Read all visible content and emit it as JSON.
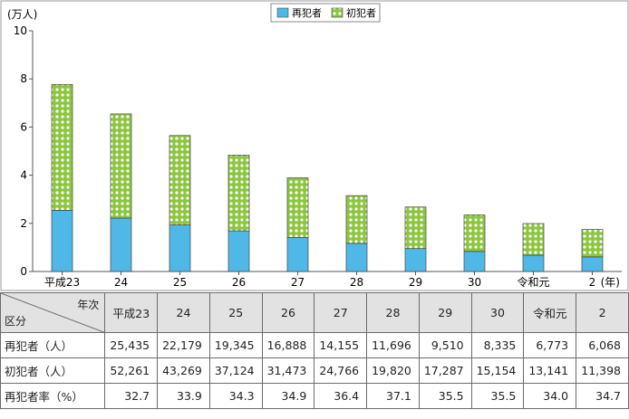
{
  "chart_data": {
    "type": "bar",
    "stacked": true,
    "categories": [
      "平成23",
      "24",
      "25",
      "26",
      "27",
      "28",
      "29",
      "30",
      "令和元",
      "2"
    ],
    "category_unit": "(年)",
    "series": [
      {
        "name": "再犯者",
        "color": "#4fb8e6",
        "values": [
          2.5435,
          2.2179,
          1.9345,
          1.6888,
          1.4155,
          1.1696,
          0.951,
          0.8335,
          0.6773,
          0.6068
        ]
      },
      {
        "name": "初犯者",
        "color": "#8cc63e",
        "pattern": "dotted",
        "values": [
          5.2261,
          4.3269,
          3.7124,
          3.1473,
          2.4766,
          1.982,
          1.7287,
          1.5154,
          1.3141,
          1.1398
        ]
      }
    ],
    "y_unit": "(万人)",
    "yticks": [
      "0",
      "2",
      "4",
      "6",
      "8",
      "10"
    ],
    "ylim": [
      0,
      10
    ],
    "grid": false,
    "legend": "top-center"
  },
  "table": {
    "corner_top": "年次",
    "corner_bottom": "区分",
    "years": [
      "平成23",
      "24",
      "25",
      "26",
      "27",
      "28",
      "29",
      "30",
      "令和元",
      "2"
    ],
    "rows": [
      {
        "label": "再犯者（人）",
        "values": [
          "25,435",
          "22,179",
          "19,345",
          "16,888",
          "14,155",
          "11,696",
          "9,510",
          "8,335",
          "6,773",
          "6,068"
        ]
      },
      {
        "label": "初犯者（人）",
        "values": [
          "52,261",
          "43,269",
          "37,124",
          "31,473",
          "24,766",
          "19,820",
          "17,287",
          "15,154",
          "13,141",
          "11,398"
        ]
      },
      {
        "label": "再犯者率（%）",
        "values": [
          "32.7",
          "33.9",
          "34.3",
          "34.9",
          "36.4",
          "37.1",
          "35.5",
          "35.5",
          "34.0",
          "34.7"
        ]
      }
    ]
  }
}
